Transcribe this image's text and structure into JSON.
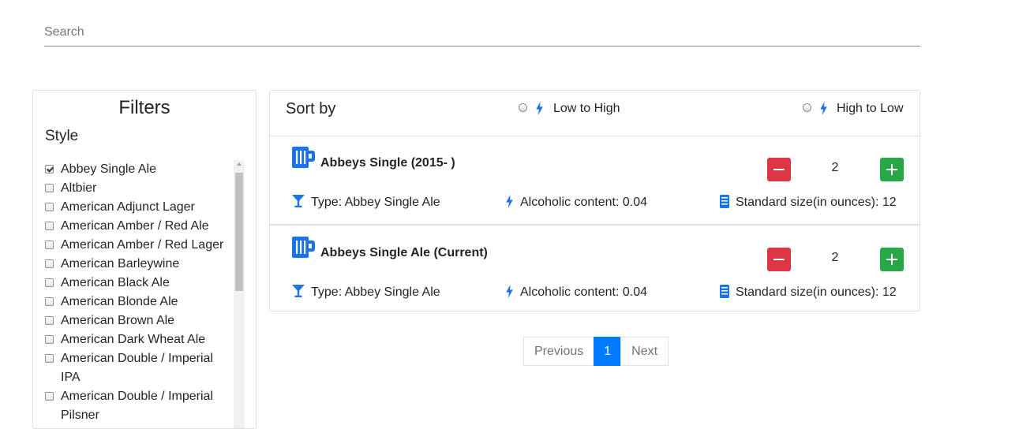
{
  "search": {
    "placeholder": "Search",
    "value": ""
  },
  "filters": {
    "title": "Filters",
    "style_label": "Style",
    "items": [
      {
        "label": "Abbey Single Ale",
        "checked": true
      },
      {
        "label": "Altbier",
        "checked": false
      },
      {
        "label": "American Adjunct Lager",
        "checked": false
      },
      {
        "label": "American Amber / Red Ale",
        "checked": false
      },
      {
        "label": "American Amber / Red Lager",
        "checked": false
      },
      {
        "label": "American Barleywine",
        "checked": false
      },
      {
        "label": "American Black Ale",
        "checked": false
      },
      {
        "label": "American Blonde Ale",
        "checked": false
      },
      {
        "label": "American Brown Ale",
        "checked": false
      },
      {
        "label": "American Dark Wheat Ale",
        "checked": false
      },
      {
        "label": "American Double / Imperial IPA",
        "checked": false
      },
      {
        "label": "American Double / Imperial Pilsner",
        "checked": false
      }
    ]
  },
  "sort": {
    "label": "Sort by",
    "low_to_high": "Low to High",
    "high_to_low": "High to Low"
  },
  "beers": [
    {
      "name": "Abbeys Single (2015- )",
      "quantity": "2",
      "type": "Type: Abbey Single Ale",
      "abv": "Alcoholic content: 0.04",
      "size": "Standard size(in ounces): 12"
    },
    {
      "name": "Abbeys Single Ale (Current)",
      "quantity": "2",
      "type": "Type: Abbey Single Ale",
      "abv": "Alcoholic content: 0.04",
      "size": "Standard size(in ounces): 12"
    }
  ],
  "pagination": {
    "previous": "Previous",
    "current": "1",
    "next": "Next"
  },
  "colors": {
    "accent": "#007bff",
    "minus": "#dc3545",
    "plus": "#28a745",
    "icon": "#1a73e8"
  },
  "icons": {
    "mug": "beer-mug-icon",
    "type": "cocktail-glass-icon",
    "abv": "lightning-bolt-icon",
    "size": "can-icon"
  }
}
